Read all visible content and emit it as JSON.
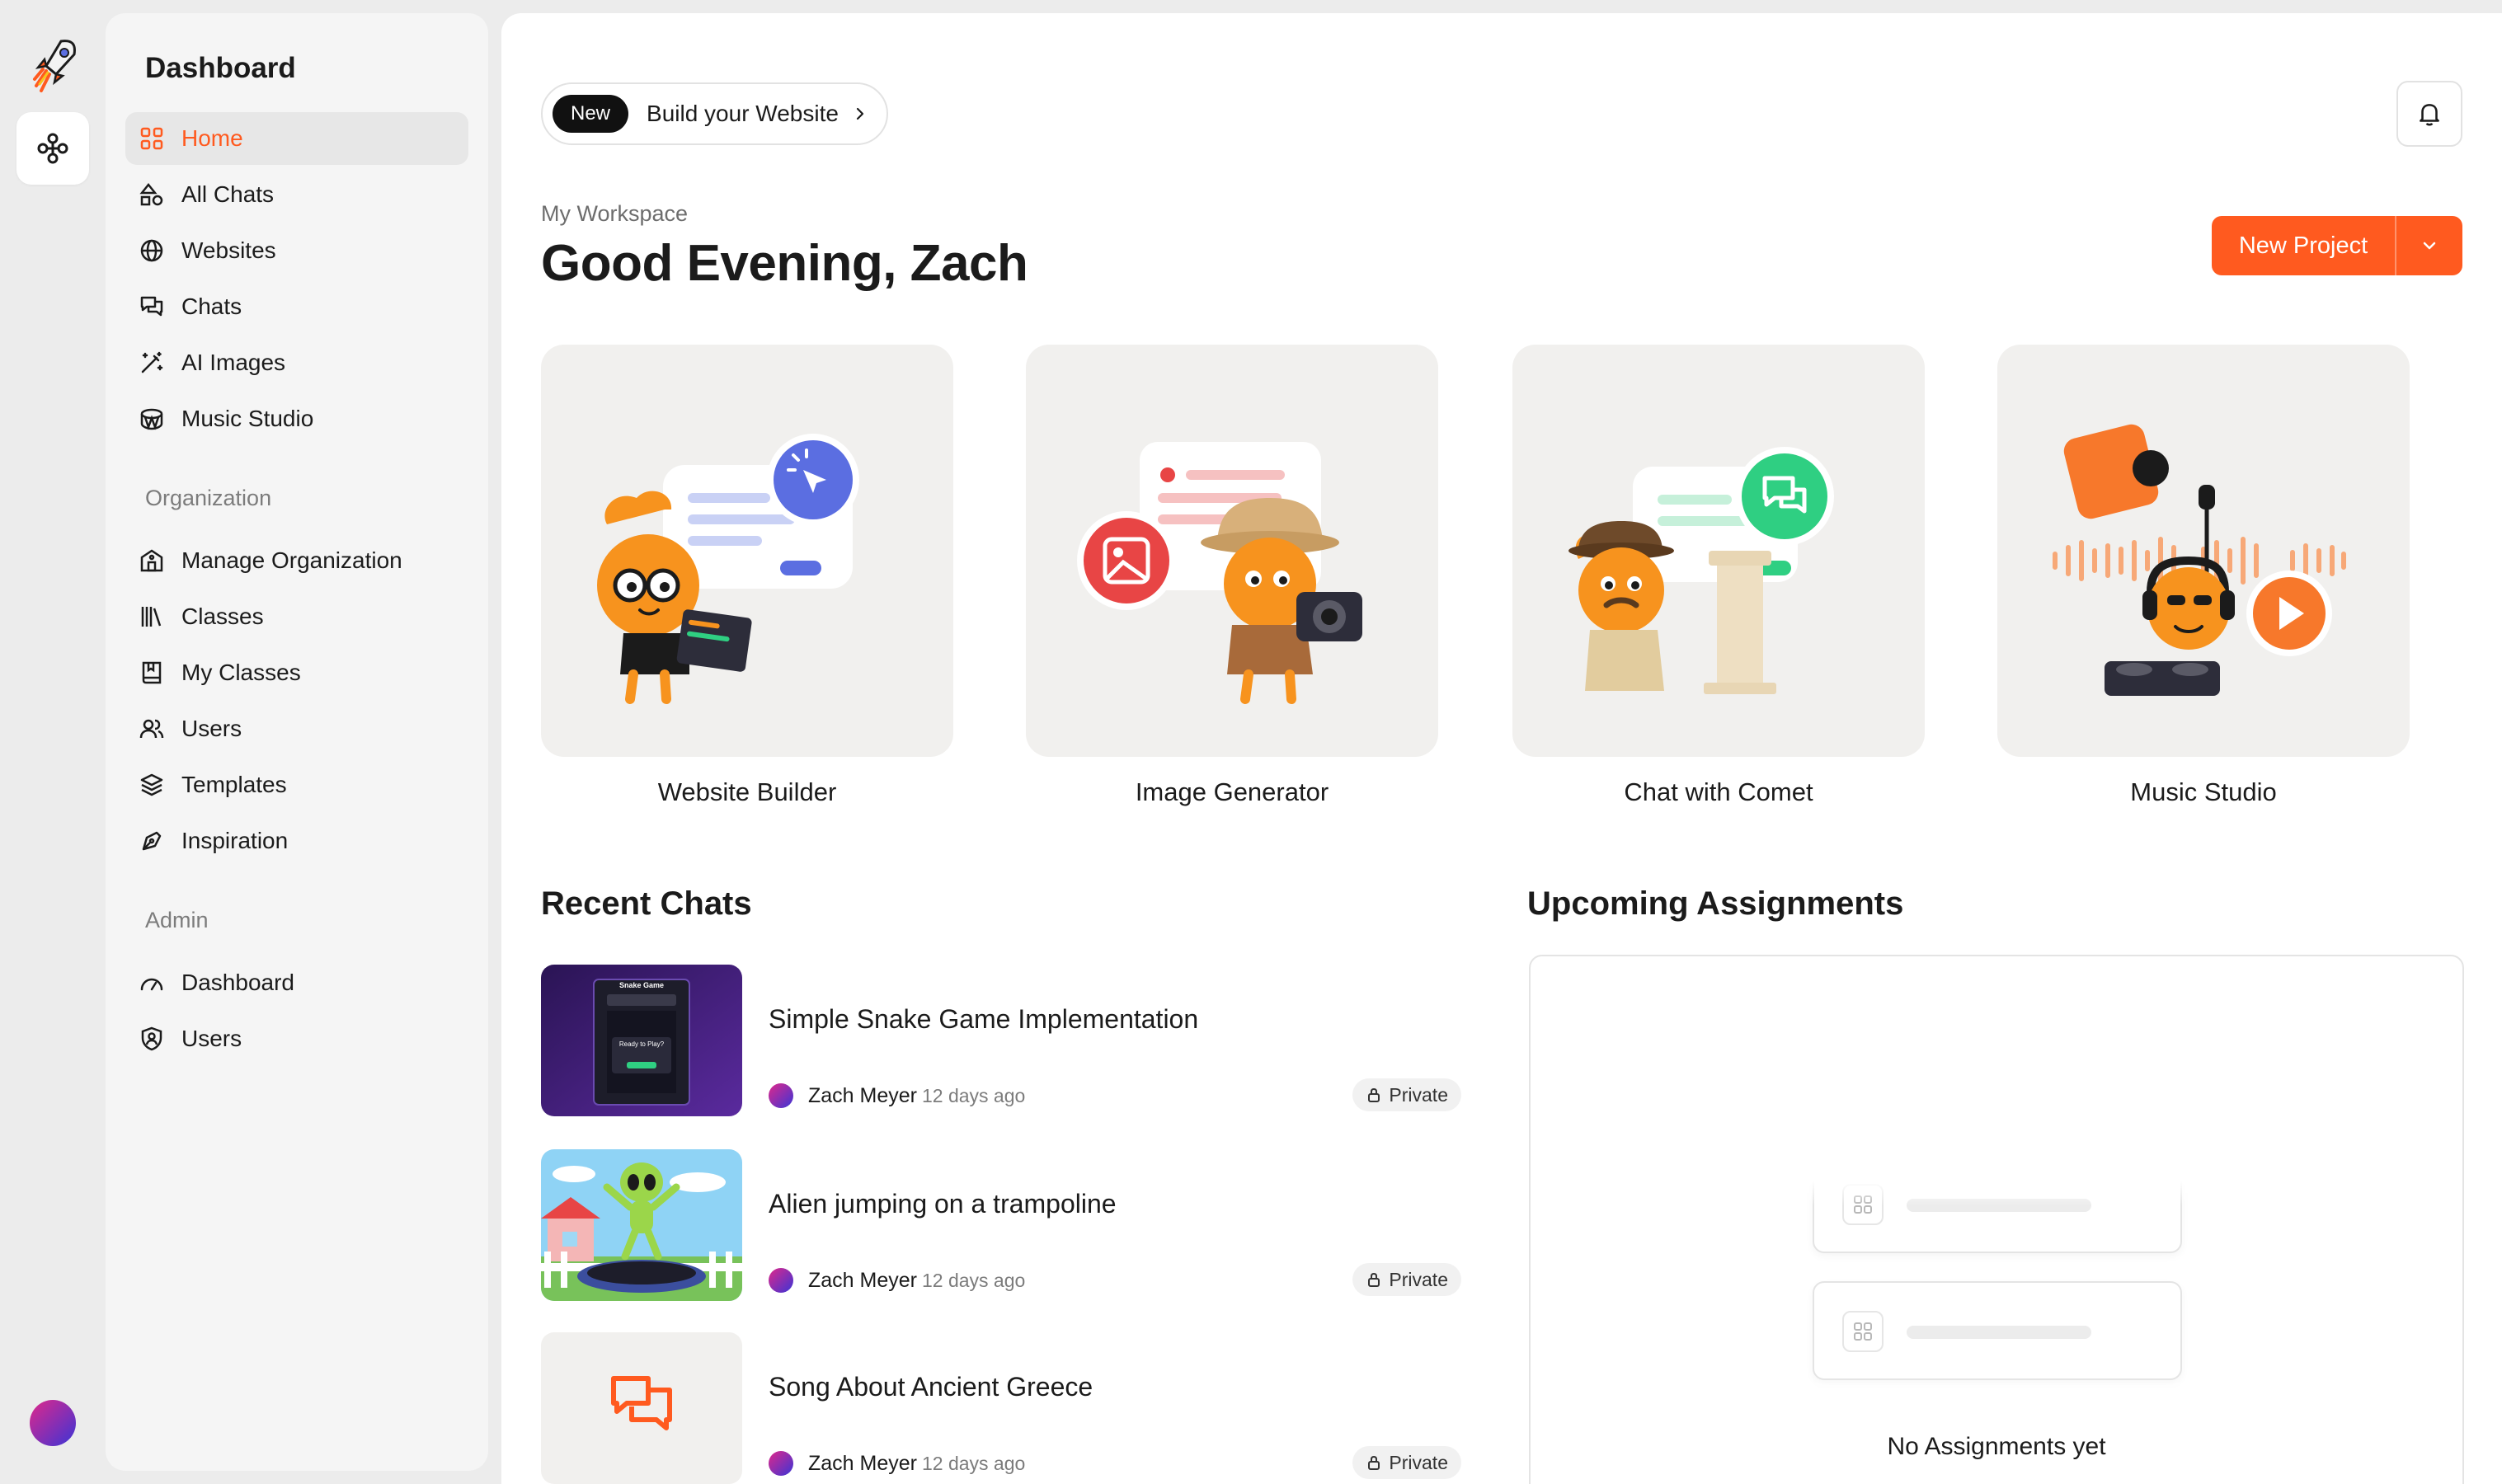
{
  "sidebar": {
    "title": "Dashboard",
    "items": [
      {
        "label": "Home",
        "icon": "grid-icon",
        "active": true
      },
      {
        "label": "All Chats",
        "icon": "shapes-icon"
      },
      {
        "label": "Websites",
        "icon": "globe-icon"
      },
      {
        "label": "Chats",
        "icon": "chat-bubbles-icon"
      },
      {
        "label": "AI Images",
        "icon": "magic-wand-icon"
      },
      {
        "label": "Music Studio",
        "icon": "drum-icon"
      }
    ],
    "org_section": "Organization",
    "org_items": [
      {
        "label": "Manage Organization",
        "icon": "building-icon"
      },
      {
        "label": "Classes",
        "icon": "library-icon"
      },
      {
        "label": "My Classes",
        "icon": "book-icon"
      },
      {
        "label": "Users",
        "icon": "users-icon"
      },
      {
        "label": "Templates",
        "icon": "layers-icon"
      },
      {
        "label": "Inspiration",
        "icon": "pen-tool-icon"
      }
    ],
    "admin_section": "Admin",
    "admin_items": [
      {
        "label": "Dashboard",
        "icon": "gauge-icon"
      },
      {
        "label": "Users",
        "icon": "shield-user-icon"
      }
    ]
  },
  "header": {
    "badge": "New",
    "promo": "Build your Website",
    "workspace": "My Workspace",
    "greeting": "Good Evening, Zach",
    "new_project": "New Project"
  },
  "cards": [
    {
      "title": "Website Builder"
    },
    {
      "title": "Image Generator"
    },
    {
      "title": "Chat with Comet"
    },
    {
      "title": "Music Studio"
    }
  ],
  "recent_chats": {
    "heading": "Recent Chats",
    "items": [
      {
        "title": "Simple Snake Game Implementation",
        "author": "Zach Meyer",
        "time": "12 days ago",
        "visibility": "Private",
        "thumb": "snake-game"
      },
      {
        "title": "Alien jumping on a trampoline",
        "author": "Zach Meyer",
        "time": "12 days ago",
        "visibility": "Private",
        "thumb": "alien-trampoline"
      },
      {
        "title": "Song About Ancient Greece",
        "author": "Zach Meyer",
        "time": "12 days ago",
        "visibility": "Private",
        "thumb": "chat-icon"
      }
    ]
  },
  "assignments": {
    "heading": "Upcoming Assignments",
    "empty": "No Assignments yet"
  },
  "snake_thumb": {
    "title": "Snake Game",
    "subtitle": "Ready to Play?"
  },
  "colors": {
    "accent": "#ff5a1f",
    "mascot": "#f7931e",
    "website_btn": "#5b6ee1",
    "image_btn": "#e84545",
    "chat_btn": "#2fcf82"
  }
}
